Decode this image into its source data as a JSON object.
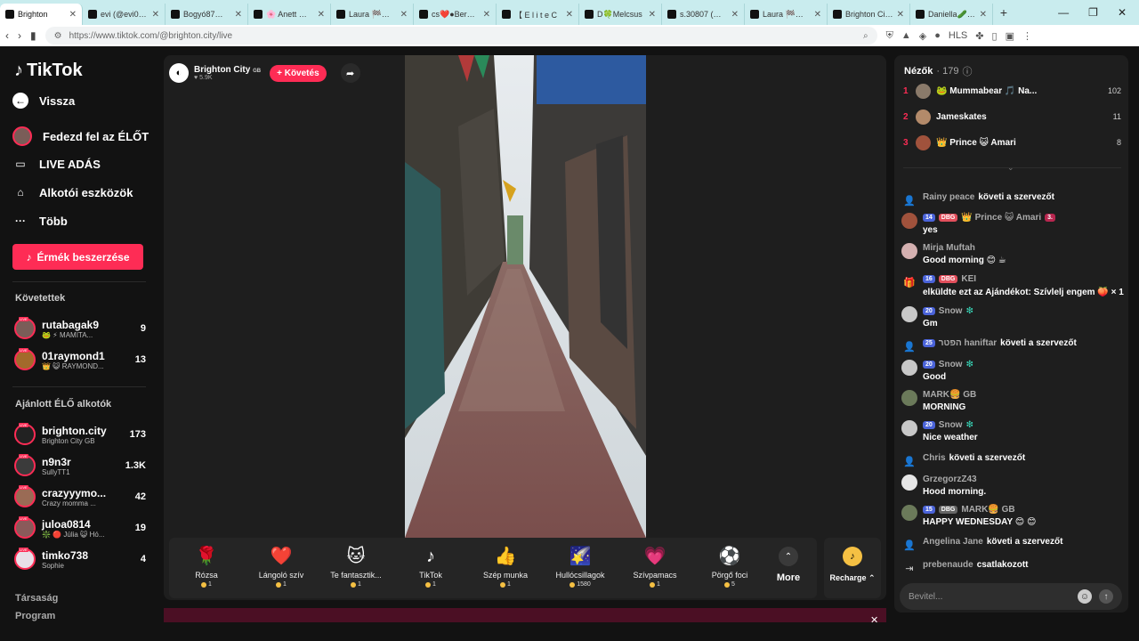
{
  "browser": {
    "tabs": [
      {
        "label": "Brighton"
      },
      {
        "label": "evi (@evi0013d"
      },
      {
        "label": "Bogyó87🥒🥒"
      },
      {
        "label": "🌸 Anett ♡ 🌸"
      },
      {
        "label": "Laura 🏁🚨🐍 F"
      },
      {
        "label": "cs❤️●Beréke🌹"
      },
      {
        "label": "【 E l i t e C"
      },
      {
        "label": "D🍀Melcsus"
      },
      {
        "label": "s.30807 (@s.30"
      },
      {
        "label": "Laura 🏁🚨🐍 F"
      },
      {
        "label": "Brighton City on"
      },
      {
        "label": "Daniella🥒🥒"
      }
    ],
    "url": "https://www.tiktok.com/@brighton.city/live"
  },
  "sidebar": {
    "logo": "TikTok",
    "back": "Vissza",
    "nav": [
      {
        "label": "Fedezd fel az ÉLŐT"
      },
      {
        "label": "LIVE ADÁS"
      },
      {
        "label": "Alkotói eszközök"
      },
      {
        "label": "Több"
      }
    ],
    "coin_button": "Érmék beszerzése",
    "following_title": "Követettek",
    "following": [
      {
        "name": "rutabagak9",
        "sub": "🐸 ⚡ MAMITA...",
        "count": "9"
      },
      {
        "name": "01raymond1",
        "sub": "👑 😺 RAYMOND...",
        "count": "13"
      }
    ],
    "recommended_title": "Ajánlott ÉLŐ alkotók",
    "recommended": [
      {
        "name": "brighton.city",
        "sub": "Brighton City GB",
        "count": "173"
      },
      {
        "name": "n9n3r",
        "sub": "SullyTT1",
        "count": "1.3K"
      },
      {
        "name": "crazyyymo...",
        "sub": "Crazy momma ...",
        "count": "42"
      },
      {
        "name": "juloa0814",
        "sub": "❇️ 🔴 Júlia 😺 Hó...",
        "count": "19"
      },
      {
        "name": "timko738",
        "sub": "Sophie",
        "count": "4"
      }
    ],
    "footer": [
      "Társaság",
      "Program"
    ]
  },
  "host": {
    "name": "Brighton City",
    "flag": "GB",
    "likes": "♥ 5.9K",
    "follow": "+ Követés"
  },
  "gifts": [
    {
      "icon": "🌹",
      "name": "Rózsa",
      "price": "1"
    },
    {
      "icon": "❤️",
      "name": "Lángoló szív",
      "price": "1"
    },
    {
      "icon": "🐱",
      "name": "Te fantasztik...",
      "price": "1"
    },
    {
      "icon": "♪",
      "name": "TikTok",
      "price": "1"
    },
    {
      "icon": "👍",
      "name": "Szép munka",
      "price": "1"
    },
    {
      "icon": "🌠",
      "name": "Hullócsillagok",
      "price": "1580"
    },
    {
      "icon": "💗",
      "name": "Szívpamacs",
      "price": "1"
    },
    {
      "icon": "⚽",
      "name": "Pörgő foci",
      "price": "5"
    }
  ],
  "more_label": "More",
  "recharge_label": "Recharge",
  "chat": {
    "viewers_label": "Nézők",
    "viewers_count": "· 179",
    "top": [
      {
        "rank": "1",
        "name": "🐸 Mummabear 🎵 Na...",
        "score": "102"
      },
      {
        "rank": "2",
        "name": "Jameskates",
        "score": "11"
      },
      {
        "rank": "3",
        "name": "👑 Prince 😺 Amari",
        "score": "8"
      }
    ],
    "messages": [
      {
        "user": "Rainy peace",
        "text": "követi a szervezőt"
      },
      {
        "badge1": "14",
        "badge2": "DBG",
        "user": "👑 Prince 😺 Amari",
        "badge3": "3.",
        "text": "yes"
      },
      {
        "user": "Mirja Muftah",
        "text": "Good morning 😊 ☕"
      },
      {
        "badge1": "16",
        "badge2": "DBG",
        "user": "KEI",
        "text": "elküldte ezt az Ajándékot: Szívlelj engem 🍑 × 1"
      },
      {
        "badge1": "20",
        "user": "Snow",
        "text": "Gm"
      },
      {
        "badge1": "25",
        "user": "הפטר haniftar",
        "text": "követi a szervezőt"
      },
      {
        "badge1": "20",
        "user": "Snow",
        "text": "Good"
      },
      {
        "user": "MARK🍔 GB",
        "text": "MORNING"
      },
      {
        "badge1": "20",
        "user": "Snow",
        "text": "Nice weather"
      },
      {
        "user": "Chris",
        "text": "követi a szervezőt"
      },
      {
        "user": "GrzegorzZ43",
        "text": "Hood morning."
      },
      {
        "badge1": "15",
        "badge2": "DBG",
        "user": "MARK🍔 GB",
        "text": "HAPPY WEDNESDAY 😊 😊"
      },
      {
        "user": "Angelina Jane",
        "text": "követi a szervezőt"
      },
      {
        "user": "prebenaude",
        "text": "csatlakozott"
      }
    ],
    "input_placeholder": "Bevitel..."
  },
  "colors": {
    "accent": "#fe2c55",
    "background": "#121212",
    "panel": "#1e1e1e",
    "tabbar": "#c9ecee"
  }
}
